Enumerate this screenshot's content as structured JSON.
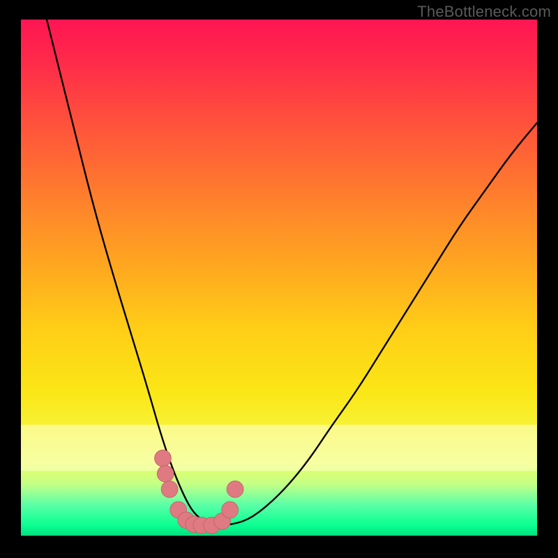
{
  "watermark": "TheBottleneck.com",
  "chart_data": {
    "type": "line",
    "title": "",
    "xlabel": "",
    "ylabel": "",
    "xlim": [
      0,
      100
    ],
    "ylim": [
      0,
      100
    ],
    "series": [
      {
        "name": "bottleneck-curve",
        "x": [
          5,
          10,
          14,
          18,
          22,
          25,
          27,
          29,
          31,
          33,
          35,
          37,
          40,
          44,
          48,
          52,
          56,
          60,
          65,
          70,
          75,
          80,
          85,
          90,
          95,
          100
        ],
        "y": [
          100,
          80,
          64,
          50,
          37,
          27,
          20,
          14,
          9,
          5,
          3,
          2,
          2,
          3,
          6,
          10,
          15,
          21,
          28,
          36,
          44,
          52,
          60,
          67,
          74,
          80
        ]
      }
    ],
    "beads": {
      "name": "highlight-points",
      "x": [
        27.5,
        28.0,
        28.8,
        30.5,
        32.0,
        33.5,
        35.0,
        37.0,
        39.0,
        40.5,
        41.5
      ],
      "y": [
        15.0,
        12.0,
        9.0,
        5.0,
        3.0,
        2.2,
        2.0,
        2.0,
        2.8,
        5.0,
        9.0
      ]
    },
    "gradient_stops": [
      {
        "pos": 0,
        "color": "#ff1552"
      },
      {
        "pos": 18,
        "color": "#ff4b3e"
      },
      {
        "pos": 38,
        "color": "#ff8a29"
      },
      {
        "pos": 60,
        "color": "#ffce17"
      },
      {
        "pos": 80,
        "color": "#f6f43a"
      },
      {
        "pos": 94,
        "color": "#5bffa7"
      },
      {
        "pos": 100,
        "color": "#00e07e"
      }
    ]
  }
}
